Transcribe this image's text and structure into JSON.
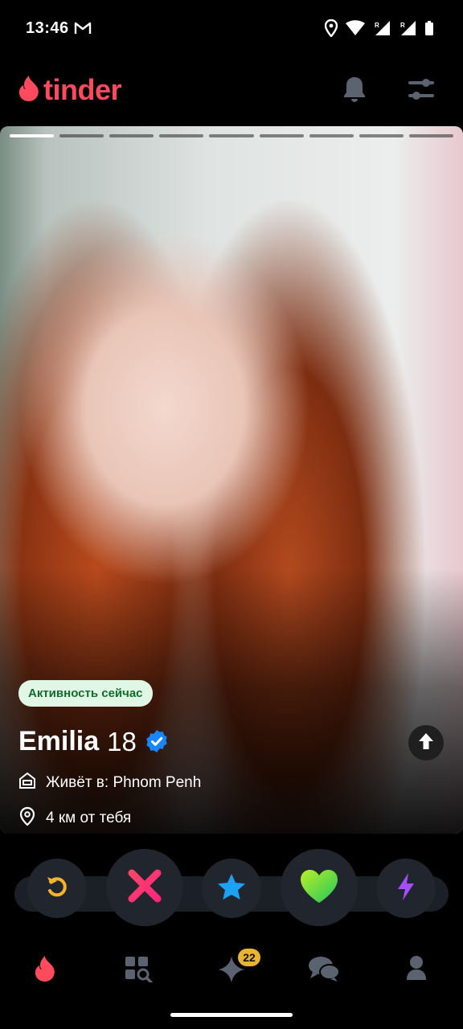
{
  "status_bar": {
    "time": "13:46"
  },
  "header": {
    "brand": "tinder"
  },
  "profile": {
    "active_badge": "Активность сейчас",
    "name": "Emilia",
    "age": "18",
    "lives_in": "Живёт в: Phnom Penh",
    "distance": "4 км от тебя",
    "photo_count": 9,
    "current_photo": 1
  },
  "bottom_nav": {
    "likes_badge": "22"
  },
  "colors": {
    "brand": "#fd4a5c",
    "rewind": "#f5b42a",
    "nope": "#fd267d",
    "superlike": "#1da1f2",
    "like": "#65d13c",
    "boost": "#a64dff",
    "active_badge_bg": "#e1f7e6",
    "likes_badge_bg": "#e9b531"
  },
  "icons": [
    "flame-icon",
    "bell-icon",
    "filters-icon",
    "location-icon",
    "home-icon",
    "verified-icon",
    "info-up-icon",
    "rewind-icon",
    "nope-icon",
    "superlike-icon",
    "like-icon",
    "boost-icon",
    "explore-icon",
    "likes-icon",
    "chat-icon",
    "profile-icon"
  ]
}
